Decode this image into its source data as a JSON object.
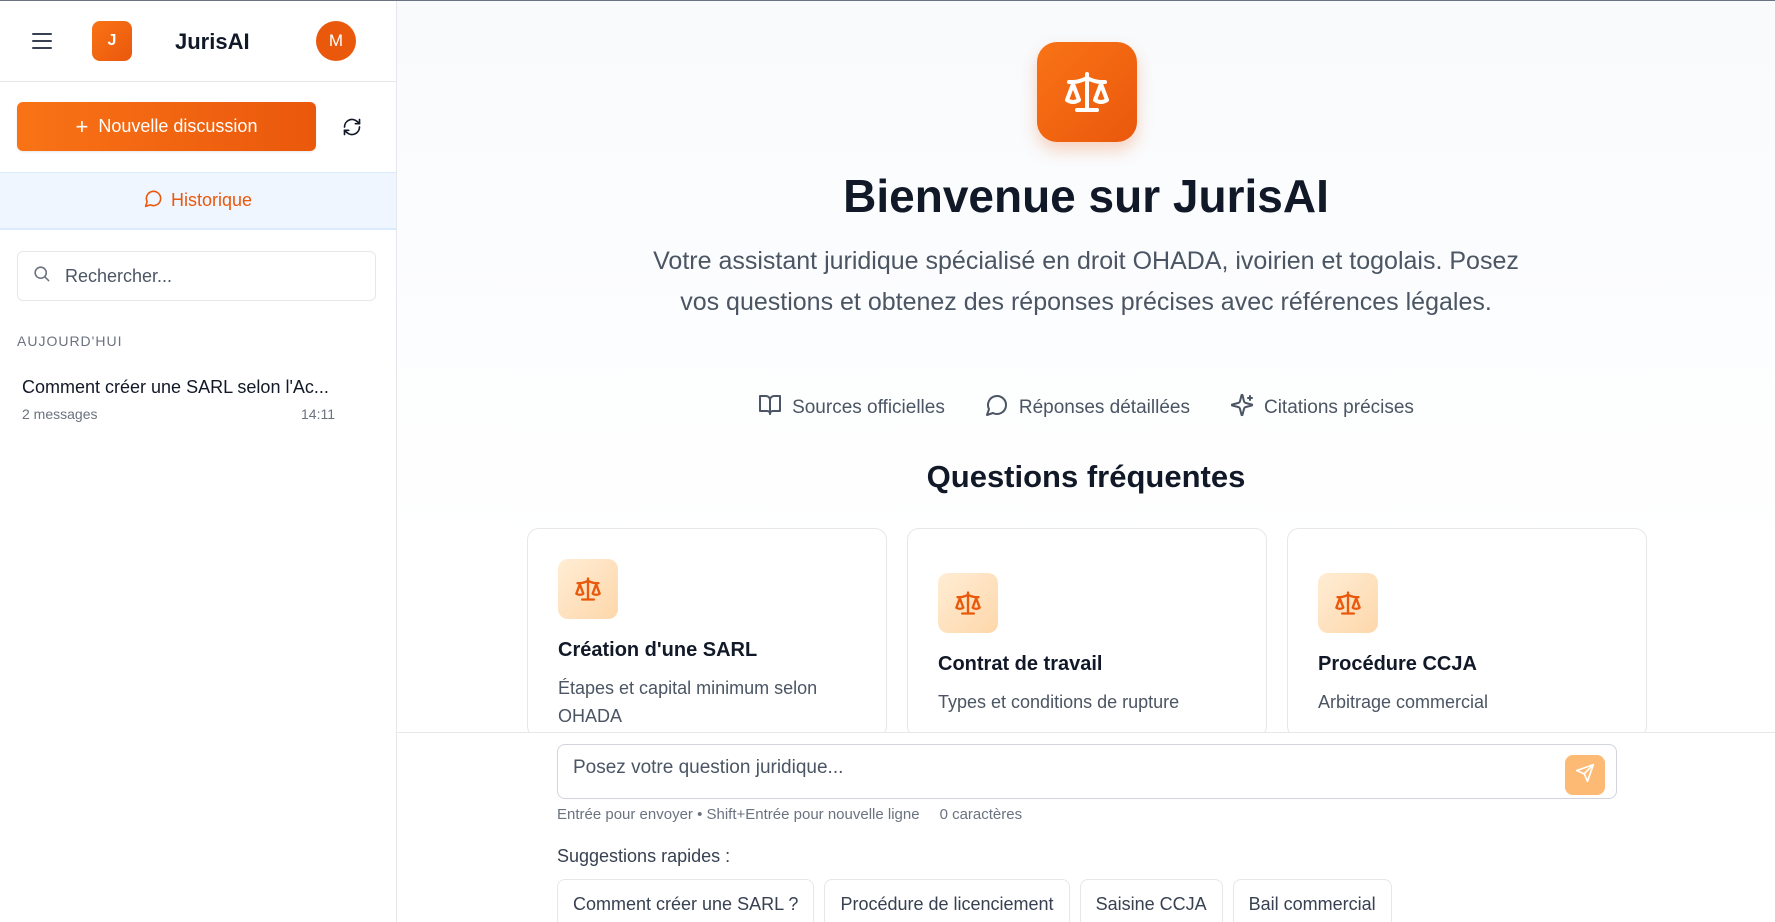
{
  "sidebar": {
    "logo_letter": "J",
    "app_name": "JurisAI",
    "avatar_letter": "M",
    "new_discussion_label": "Nouvelle discussion",
    "history_tab_label": "Historique",
    "search_placeholder": "Rechercher...",
    "section_today": "AUJOURD'HUI",
    "conversations": [
      {
        "title": "Comment créer une SARL selon l'Ac...",
        "count": "2 messages",
        "time": "14:11"
      }
    ]
  },
  "main": {
    "title": "Bienvenue sur JurisAI",
    "subtitle": "Votre assistant juridique spécialisé en droit OHADA, ivoirien et togolais. Posez vos questions et obtenez des réponses précises avec références légales.",
    "features": [
      {
        "icon": "book-icon",
        "label": "Sources officielles"
      },
      {
        "icon": "message-circle-icon",
        "label": "Réponses détaillées"
      },
      {
        "icon": "sparkles-icon",
        "label": "Citations précises"
      }
    ],
    "faq_title": "Questions fréquentes",
    "cards": [
      {
        "icon": "scale-icon",
        "title": "Création d'une SARL",
        "desc": "Étapes et capital minimum selon OHADA"
      },
      {
        "icon": "scale-icon",
        "title": "Contrat de travail",
        "desc": "Types et conditions de rupture"
      },
      {
        "icon": "scale-icon",
        "title": "Procédure CCJA",
        "desc": "Arbitrage commercial"
      }
    ]
  },
  "composer": {
    "placeholder": "Posez votre question juridique...",
    "hint": "Entrée pour envoyer • Shift+Entrée pour nouvelle ligne",
    "char_count": "0 caractères",
    "quick_label": "Suggestions rapides :",
    "suggestions": [
      "Comment créer une SARL ?",
      "Procédure de licenciement",
      "Saisine CCJA",
      "Bail commercial"
    ]
  },
  "colors": {
    "accent": "#ea580c",
    "accent_light": "#f97316",
    "send_disabled": "#fdba74",
    "history_bg": "#eff6ff"
  }
}
